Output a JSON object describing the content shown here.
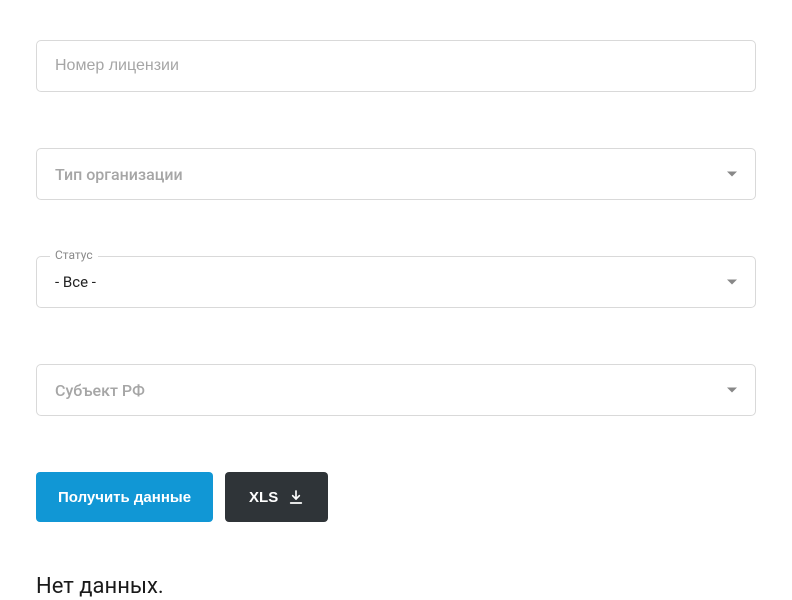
{
  "form": {
    "license": {
      "placeholder": "Номер лицензии",
      "value": ""
    },
    "orgType": {
      "placeholder": "Тип организации"
    },
    "status": {
      "label": "Статус",
      "value": "- Все -"
    },
    "region": {
      "placeholder": "Субъект РФ"
    }
  },
  "buttons": {
    "submit": "Получить данные",
    "export": "XLS"
  },
  "empty": "Нет данных."
}
